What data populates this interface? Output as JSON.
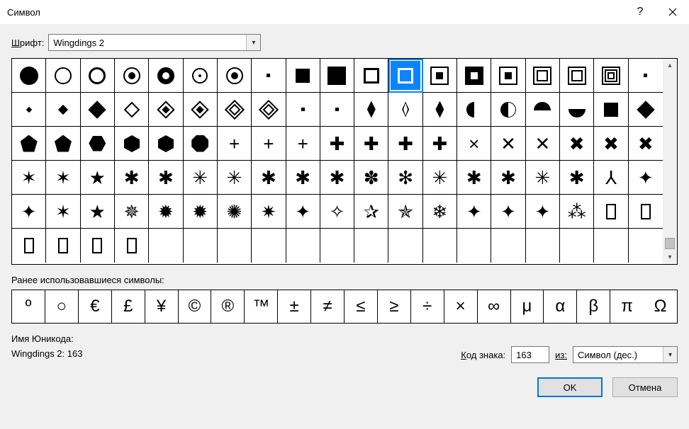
{
  "title": "Символ",
  "font_label": "Шрифт:",
  "font_value": "Wingdings 2",
  "recent_label": "Ранее использовавшиеся символы:",
  "unicode_name_label": "Имя Юникода:",
  "unicode_name_value": "Wingdings 2: 163",
  "code_label": "Код знака:",
  "code_value": "163",
  "from_label": "из:",
  "from_value": "Символ (дес.)",
  "ok_label": "OK",
  "cancel_label": "Отмена",
  "selected_index": 11,
  "grid": [
    [
      {
        "t": "shape",
        "c": "circ-solid",
        "n": "circle-solid-large"
      },
      {
        "t": "shape",
        "c": "circ-hollow",
        "n": "circle-hollow"
      },
      {
        "t": "shape",
        "c": "circ-hollow bold",
        "n": "circle-hollow-bold"
      },
      {
        "t": "shape",
        "c": "circ-target",
        "n": "circle-target"
      },
      {
        "t": "shape",
        "c": "circ-target inv",
        "n": "circle-target-inverse"
      },
      {
        "t": "shape",
        "c": "circ-dot",
        "n": "circle-dot"
      },
      {
        "t": "shape",
        "c": "circ-target",
        "n": "circle-bullseye"
      },
      {
        "t": "shape",
        "c": "dot-tiny",
        "n": "dot-tiny"
      },
      {
        "t": "shape",
        "c": "square-solid",
        "n": "square-solid-small"
      },
      {
        "t": "shape",
        "c": "square-solid lg",
        "n": "square-solid-large"
      },
      {
        "t": "shape",
        "c": "square-hollow",
        "n": "square-hollow-thin"
      },
      {
        "t": "shape",
        "c": "square-hollow",
        "n": "square-hollow-bold",
        "sel": true
      },
      {
        "t": "shape",
        "c": "square-target",
        "n": "square-target"
      },
      {
        "t": "shape",
        "c": "square-inv",
        "n": "square-inverse"
      },
      {
        "t": "shape",
        "c": "square-target",
        "n": "square-bullseye"
      },
      {
        "t": "shape",
        "c": "square-frames",
        "n": "square-frames"
      },
      {
        "t": "shape",
        "c": "square-frames",
        "n": "square-double"
      },
      {
        "t": "shape",
        "c": "square-frames3",
        "n": "square-triple"
      },
      {
        "t": "shape",
        "c": "dot-tiny",
        "n": "dot-corner"
      }
    ],
    [
      {
        "t": "shape",
        "c": "diamond tiny",
        "n": "diamond-tiny"
      },
      {
        "t": "shape",
        "c": "diamond sm",
        "n": "diamond-small"
      },
      {
        "t": "shape",
        "c": "diamond",
        "n": "diamond-solid"
      },
      {
        "t": "shape",
        "c": "diamond-h",
        "n": "diamond-hollow"
      },
      {
        "t": "shape",
        "c": "diamond-t",
        "n": "diamond-target"
      },
      {
        "t": "shape",
        "c": "diamond-t",
        "n": "diamond-bullseye"
      },
      {
        "t": "shape",
        "c": "diamond-f",
        "n": "diamond-frames"
      },
      {
        "t": "shape",
        "c": "diamond-f",
        "n": "diamond-double"
      },
      {
        "t": "shape",
        "c": "dot-tiny",
        "n": "dot-small-a"
      },
      {
        "t": "shape",
        "c": "dot-tiny",
        "n": "dot-small-b"
      },
      {
        "t": "shape",
        "c": "loz-v",
        "n": "lozenge-solid"
      },
      {
        "t": "shape",
        "c": "loz-v h",
        "n": "lozenge-hollow"
      },
      {
        "t": "shape",
        "c": "loz-v",
        "n": "lozenge-bold"
      },
      {
        "t": "shape",
        "c": "halfcirc-l",
        "n": "half-circle-left"
      },
      {
        "t": "shape",
        "c": "halfcirc-r",
        "n": "half-circle-right"
      },
      {
        "t": "shape",
        "c": "halfcirc-t",
        "n": "half-circle-top"
      },
      {
        "t": "shape",
        "c": "halfcirc-b",
        "n": "half-circle-bottom"
      },
      {
        "t": "shape",
        "c": "square-solid",
        "n": "square-mid"
      },
      {
        "t": "shape",
        "c": "diamond",
        "n": "diamond-large"
      }
    ],
    [
      {
        "t": "shape",
        "c": "pent",
        "n": "pentagon-solid"
      },
      {
        "t": "shape",
        "c": "pent",
        "n": "pentagon-bold"
      },
      {
        "t": "shape",
        "c": "hex",
        "n": "hexagon-h-solid"
      },
      {
        "t": "shape",
        "c": "hex v",
        "n": "hexagon-v-solid"
      },
      {
        "t": "shape",
        "c": "hex v",
        "n": "hexagon-v-bold"
      },
      {
        "t": "shape",
        "c": "oct",
        "n": "octagon-solid"
      },
      {
        "t": "txt",
        "g": "+",
        "n": "plus-thin"
      },
      {
        "t": "txt",
        "g": "+",
        "n": "plus-light"
      },
      {
        "t": "txt",
        "g": "+",
        "n": "plus-medium"
      },
      {
        "t": "txt",
        "g": "✚",
        "n": "plus-heavy"
      },
      {
        "t": "txt",
        "g": "✚",
        "n": "plus-bold"
      },
      {
        "t": "txt",
        "g": "✚",
        "n": "plus-black"
      },
      {
        "t": "txt",
        "g": "✚",
        "n": "plus-fat"
      },
      {
        "t": "txt",
        "g": "×",
        "n": "times-thin"
      },
      {
        "t": "txt",
        "g": "✕",
        "n": "times-medium"
      },
      {
        "t": "txt",
        "g": "✕",
        "n": "times-bold"
      },
      {
        "t": "txt",
        "g": "✖",
        "n": "times-heavy"
      },
      {
        "t": "txt",
        "g": "✖",
        "n": "times-black"
      },
      {
        "t": "txt",
        "g": "✖",
        "n": "times-fat"
      }
    ],
    [
      {
        "t": "txt",
        "g": "✶",
        "n": "star6-outline"
      },
      {
        "t": "txt",
        "g": "✶",
        "n": "star5-thin"
      },
      {
        "t": "txt",
        "g": "★",
        "n": "star5-solid"
      },
      {
        "t": "txt",
        "g": "✱",
        "n": "asterisk-bold"
      },
      {
        "t": "txt",
        "g": "✱",
        "n": "asterisk-heavy"
      },
      {
        "t": "txt",
        "g": "✳",
        "n": "asterisk-6"
      },
      {
        "t": "txt",
        "g": "✳",
        "n": "asterisk-6b"
      },
      {
        "t": "txt",
        "g": "✱",
        "n": "asterisk-5"
      },
      {
        "t": "txt",
        "g": "✱",
        "n": "asterisk-5b"
      },
      {
        "t": "txt",
        "g": "✱",
        "n": "asterisk-5c"
      },
      {
        "t": "txt",
        "g": "✽",
        "n": "asterisk-flower"
      },
      {
        "t": "txt",
        "g": "✻",
        "n": "asterisk-open"
      },
      {
        "t": "txt",
        "g": "✳",
        "n": "asterisk-8"
      },
      {
        "t": "txt",
        "g": "✱",
        "n": "asterisk-round"
      },
      {
        "t": "txt",
        "g": "✱",
        "n": "asterisk-rounder"
      },
      {
        "t": "txt",
        "g": "✳",
        "n": "asterisk-wide"
      },
      {
        "t": "txt",
        "g": "✱",
        "n": "asterisk-black"
      },
      {
        "t": "txt",
        "g": "⅄",
        "n": "tri-inverted"
      },
      {
        "t": "txt",
        "g": "✦",
        "n": "sparkle-4"
      }
    ],
    [
      {
        "t": "txt",
        "g": "✦",
        "n": "star4-solid"
      },
      {
        "t": "txt",
        "g": "✶",
        "n": "star5-line"
      },
      {
        "t": "txt",
        "g": "★",
        "n": "star5-black"
      },
      {
        "t": "txt",
        "g": "✵",
        "n": "star5-pointed"
      },
      {
        "t": "txt",
        "g": "✹",
        "n": "star6-black"
      },
      {
        "t": "txt",
        "g": "✹",
        "n": "star6-bold"
      },
      {
        "t": "txt",
        "g": "✺",
        "n": "star8-black"
      },
      {
        "t": "txt",
        "g": "✷",
        "n": "star8-bold"
      },
      {
        "t": "txt",
        "g": "✦",
        "n": "shuriken-4a"
      },
      {
        "t": "txt",
        "g": "✧",
        "n": "shuriken-4b"
      },
      {
        "t": "txt",
        "g": "✰",
        "n": "star5-gray"
      },
      {
        "t": "txt",
        "g": "✯",
        "n": "star5-outline"
      },
      {
        "t": "txt",
        "g": "❄",
        "n": "snowflake"
      },
      {
        "t": "txt",
        "g": "✦",
        "n": "sparkle-a"
      },
      {
        "t": "txt",
        "g": "✦",
        "n": "sparkle-b"
      },
      {
        "t": "txt",
        "g": "✦",
        "n": "compass-4"
      },
      {
        "t": "txt",
        "g": "⁂",
        "n": "asterism"
      },
      {
        "t": "shape",
        "c": "rect-h",
        "n": "rect-hollow-a"
      },
      {
        "t": "shape",
        "c": "rect-h",
        "n": "rect-hollow-b"
      }
    ],
    [
      {
        "t": "shape",
        "c": "rect-h",
        "n": "rect-hollow-c"
      },
      {
        "t": "shape",
        "c": "rect-h",
        "n": "rect-hollow-d"
      },
      {
        "t": "shape",
        "c": "rect-h",
        "n": "rect-hollow-e"
      },
      {
        "t": "shape",
        "c": "rect-h",
        "n": "rect-hollow-f"
      },
      {
        "t": "empty"
      },
      {
        "t": "empty"
      },
      {
        "t": "empty"
      },
      {
        "t": "empty"
      },
      {
        "t": "empty"
      },
      {
        "t": "empty"
      },
      {
        "t": "empty"
      },
      {
        "t": "empty"
      },
      {
        "t": "empty"
      },
      {
        "t": "empty"
      },
      {
        "t": "empty"
      },
      {
        "t": "empty"
      },
      {
        "t": "empty"
      },
      {
        "t": "empty"
      },
      {
        "t": "empty"
      }
    ]
  ],
  "recent": [
    {
      "g": "º",
      "n": "degree"
    },
    {
      "g": "○",
      "n": "circle-small"
    },
    {
      "g": "€",
      "n": "euro"
    },
    {
      "g": "£",
      "n": "pound"
    },
    {
      "g": "¥",
      "n": "yen"
    },
    {
      "g": "©",
      "n": "copyright"
    },
    {
      "g": "®",
      "n": "registered"
    },
    {
      "g": "™",
      "n": "trademark"
    },
    {
      "g": "±",
      "n": "plus-minus"
    },
    {
      "g": "≠",
      "n": "not-equal"
    },
    {
      "g": "≤",
      "n": "less-equal"
    },
    {
      "g": "≥",
      "n": "greater-equal"
    },
    {
      "g": "÷",
      "n": "divide"
    },
    {
      "g": "×",
      "n": "multiply"
    },
    {
      "g": "∞",
      "n": "infinity"
    },
    {
      "g": "μ",
      "n": "mu"
    },
    {
      "g": "α",
      "n": "alpha"
    },
    {
      "g": "β",
      "n": "beta"
    },
    {
      "g": "π",
      "n": "pi"
    },
    {
      "g": "Ω",
      "n": "omega"
    }
  ]
}
